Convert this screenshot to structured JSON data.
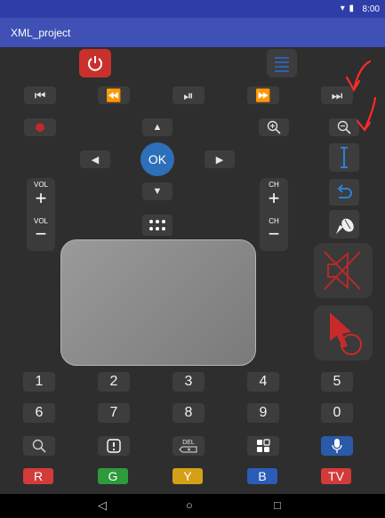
{
  "status_bar": {
    "time": "8:00",
    "icons": "▾ ▮"
  },
  "app_bar": {
    "title": "XML_project"
  },
  "remote": {
    "power": {
      "icon": "power-icon",
      "color": "#c9302c"
    },
    "menu": {
      "icon": "menu-icon",
      "color": "#2f5fb5"
    },
    "media_row": [
      {
        "name": "skip-previous",
        "glyph": "⏮"
      },
      {
        "name": "rewind",
        "glyph": "⏪"
      },
      {
        "name": "play-pause",
        "glyph": "⏯"
      },
      {
        "name": "fast-forward",
        "glyph": "⏩"
      },
      {
        "name": "skip-next",
        "glyph": "⏭"
      }
    ],
    "record": {
      "icon": "record-icon",
      "color": "#c0282a"
    },
    "dpad": {
      "up": "▲",
      "down": "▼",
      "left": "◀",
      "right": "▶",
      "ok": "OK"
    },
    "zoom_in": {
      "icon": "zoom-in-icon"
    },
    "zoom_out": {
      "icon": "zoom-out-icon"
    },
    "cursor": {
      "icon": "text-cursor-icon",
      "color": "#2f7fd6"
    },
    "back": {
      "icon": "back-arrow-icon",
      "color": "#2f7fd6"
    },
    "mouse": {
      "icon": "mouse-pointer-icon"
    },
    "vol": {
      "top_label": "VOL",
      "plus": "+",
      "bottom_label": "VOL",
      "minus": "−"
    },
    "ch": {
      "top_label": "CH",
      "plus": "+",
      "bottom_label": "CH",
      "minus": "−"
    },
    "apps": {
      "icon": "grid-dots-icon"
    },
    "mute": {
      "icon": "mute-icon",
      "color": "#b52a2a"
    },
    "pointer": {
      "icon": "pointer-click-icon",
      "color": "#c82a2a"
    },
    "numbers_row1": [
      "1",
      "2",
      "3",
      "4",
      "5"
    ],
    "numbers_row2": [
      "6",
      "7",
      "8",
      "9",
      "0"
    ],
    "bottom_row": {
      "search": {
        "icon": "search-icon"
      },
      "info": {
        "icon": "info-icon"
      },
      "delete": {
        "label": "DEL",
        "icon": "backspace-icon"
      },
      "widgets": {
        "icon": "widgets-icon"
      },
      "voice": {
        "icon": "microphone-icon",
        "color": "#2a5aa8"
      }
    },
    "color_buttons": [
      {
        "label": "R",
        "color": "#d33a3a"
      },
      {
        "label": "G",
        "color": "#2e9a3c"
      },
      {
        "label": "Y",
        "color": "#d4a017"
      },
      {
        "label": "B",
        "color": "#2a5cb8"
      },
      {
        "label": "TV",
        "color": "#d33a3a"
      }
    ]
  },
  "nav_bar": {
    "back": "◁",
    "home": "○",
    "recents": "□"
  },
  "annotation_color": "#ff2a2a"
}
